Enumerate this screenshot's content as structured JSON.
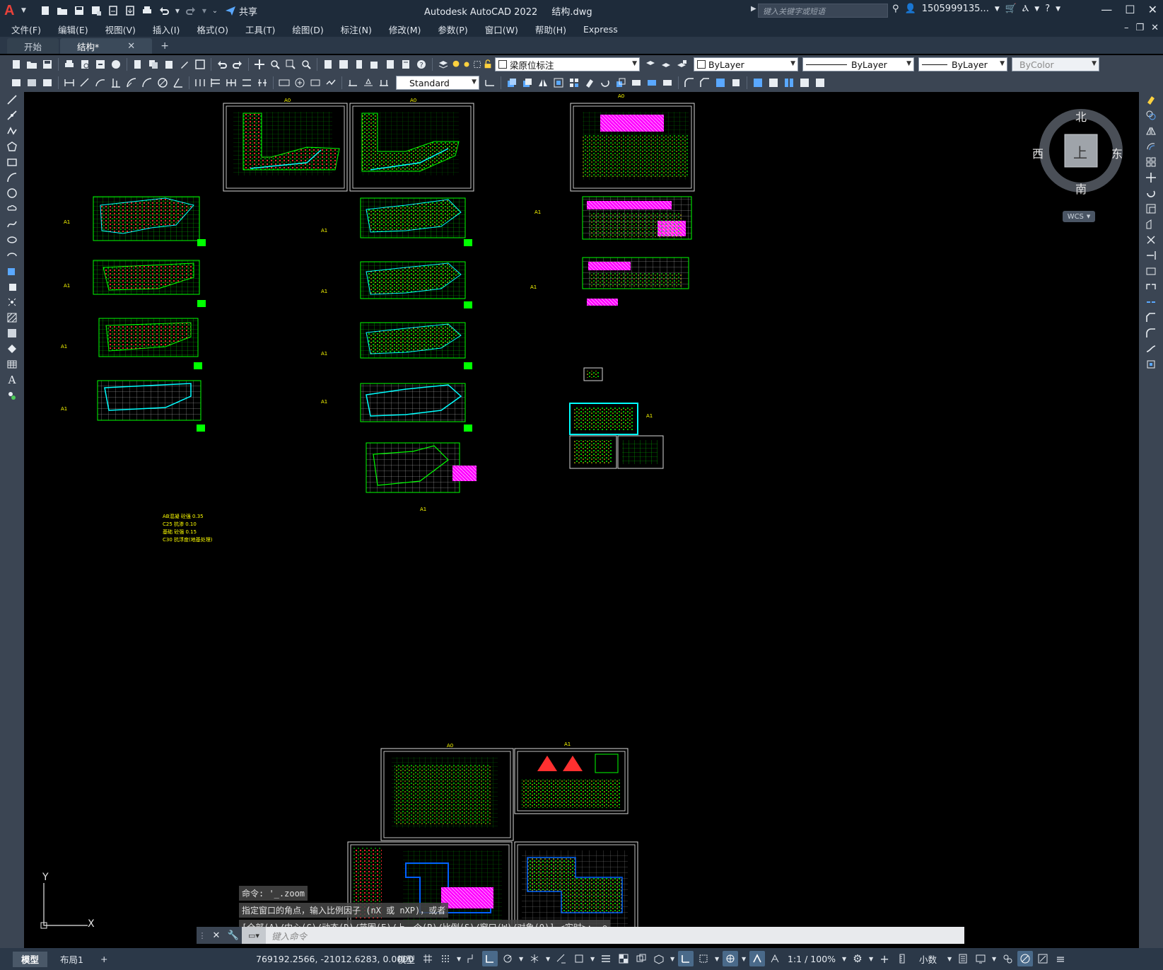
{
  "title_bar": {
    "window_title": "Autodesk AutoCAD 2022",
    "file_name": "结构.dwg",
    "share_label": "共享",
    "search_placeholder": "键入关键字或短语",
    "user_name": "1505999135...",
    "window_controls": [
      "minimize-icon",
      "maximize-icon",
      "close-icon"
    ]
  },
  "menu": {
    "items": [
      "文件(F)",
      "编辑(E)",
      "视图(V)",
      "插入(I)",
      "格式(O)",
      "工具(T)",
      "绘图(D)",
      "标注(N)",
      "修改(M)",
      "参数(P)",
      "窗口(W)",
      "帮助(H)",
      "Express"
    ]
  },
  "tabs": {
    "items": [
      {
        "label": "开始",
        "active": false
      },
      {
        "label": "结构*",
        "active": true
      }
    ],
    "add_label": "+"
  },
  "properties": {
    "layer_name": "梁原位标注",
    "color": "ByLayer",
    "linetype": "ByLayer",
    "lineweight": "ByLayer",
    "plot_style": "ByColor",
    "text_style": "Standard"
  },
  "viewcube": {
    "north": "北",
    "south": "南",
    "east": "东",
    "west": "西",
    "face": "上",
    "wcs_label": "WCS"
  },
  "ucs": {
    "x_label": "X",
    "y_label": "Y"
  },
  "command": {
    "history": [
      "命令: '_.zoom",
      "指定窗口的角点，输入比例因子 (nX 或 nXP)，或者",
      "[全部(A)/中心(C)/动态(D)/范围(E)/上一个(P)/比例(S)/窗口(W)/对象(O)] <实时>: _e"
    ],
    "placeholder": "键入命令"
  },
  "status": {
    "layout_tabs": [
      {
        "label": "模型",
        "active": true
      },
      {
        "label": "布局1",
        "active": false
      }
    ],
    "add_layout": "+",
    "coordinates": "769192.2566, -21012.6283, 0.0000",
    "space_label": "模型",
    "scale": "1:1 / 100%",
    "units": "小数"
  },
  "drawing_notes": {
    "lines": [
      "AB混凝 砼强 0.35",
      "C25 抗渗 0.10",
      "基础 砼强 0.15",
      "C30 抗浮度(地基处理)"
    ]
  },
  "colors": {
    "chrome_dark": "#1e2b3a",
    "toolbar": "#3b4553",
    "canvas": "#000000",
    "cad_green": "#00ff00",
    "cad_white": "#d0d0d0",
    "cad_magenta": "#ff00ff",
    "cad_cyan": "#00ffff",
    "cad_yellow": "#ffff00",
    "cad_red": "#ff3030"
  }
}
